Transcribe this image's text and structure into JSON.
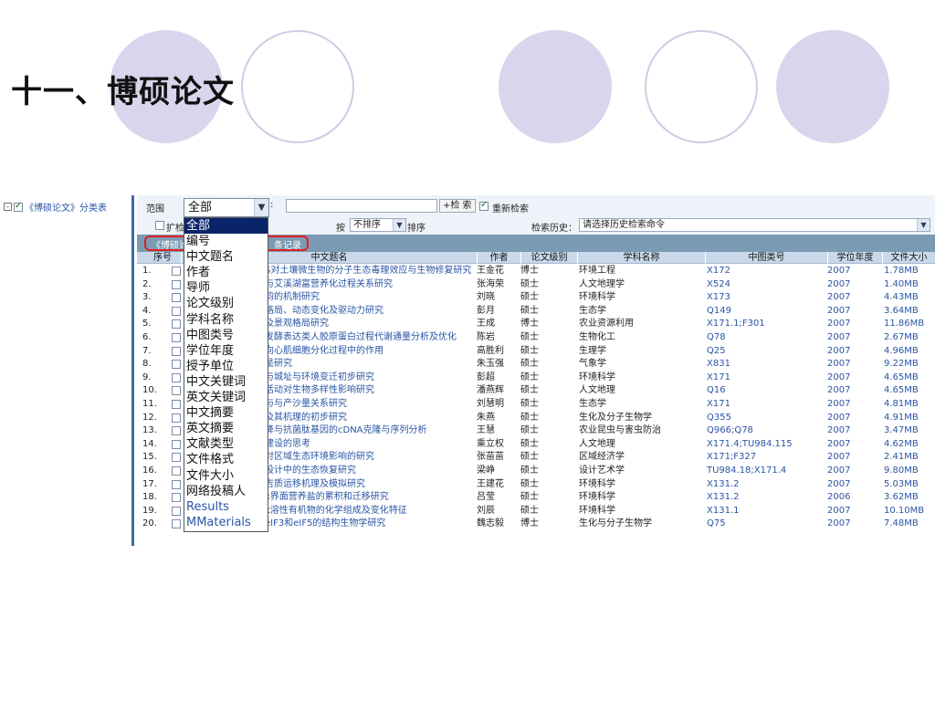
{
  "slide": {
    "title": "十一、博硕论文"
  },
  "tree": {
    "toggle": "-",
    "label": "《博硕论文》分类表"
  },
  "toolbar": {
    "range_label": "范围",
    "colon": ":",
    "search_button": "+检 索",
    "research_label": "重新检索",
    "expand_label": "扩检",
    "sort_prefix": "按",
    "sort_value": "不排序",
    "sort_suffix": "排序",
    "history_label": "检索历史：",
    "history_placeholder": "请选择历史检索命令"
  },
  "banner": {
    "left": "《博硕论",
    "right": "条记录"
  },
  "range_select": {
    "value": "全部",
    "options": [
      "全部",
      "编号",
      "中文题名",
      "作者",
      "导师",
      "论文级别",
      "学科名称",
      "中图类号",
      "学位年度",
      "授予单位",
      "中文关键词",
      "英文关键词",
      "中文摘要",
      "英文摘要",
      "文献类型",
      "文件格式",
      "文件大小",
      "网络投稿人",
      "Results",
      "MMaterials"
    ]
  },
  "table": {
    "headers": [
      "序号",
      "中文题名",
      "作者",
      "论文级别",
      "学科名称",
      "中图类号",
      "学位年度",
      "文件大小"
    ],
    "rows": [
      {
        "no": "1.",
        "title": "S对土壤微生物的分子生态毒理效应与生物修复研究",
        "author": "王金花",
        "level": "博士",
        "subject": "环境工程",
        "class": "X172",
        "year": "2007",
        "size": "1.78MB"
      },
      {
        "no": "2.",
        "title": "与艾溪湖富营养化过程关系研究",
        "author": "张海荣",
        "level": "硕士",
        "subject": "人文地理学",
        "class": "X524",
        "year": "2007",
        "size": "1.40MB"
      },
      {
        "no": "3.",
        "title": "韵的机制研究",
        "author": "刘晓",
        "level": "硕士",
        "subject": "环境科学",
        "class": "X173",
        "year": "2007",
        "size": "4.43MB"
      },
      {
        "no": "4.",
        "title": "格局、动态变化及驱动力研究",
        "author": "彭月",
        "level": "硕士",
        "subject": "生态学",
        "class": "Q149",
        "year": "2007",
        "size": "3.64MB"
      },
      {
        "no": "5.",
        "title": "及景观格局研究",
        "author": "王成",
        "level": "博士",
        "subject": "农业资源利用",
        "class": "X171.1;F301",
        "year": "2007",
        "size": "11.86MB"
      },
      {
        "no": "6.",
        "title": "发酵表达类人胶原蛋白过程代谢通量分析及优化",
        "author": "陈岩",
        "level": "硕士",
        "subject": "生物化工",
        "class": "Q78",
        "year": "2007",
        "size": "2.67MB"
      },
      {
        "no": "7.",
        "title": "向心肌细胞分化过程中的作用",
        "author": "高胜利",
        "level": "硕士",
        "subject": "生理学",
        "class": "Q25",
        "year": "2007",
        "size": "4.96MB"
      },
      {
        "no": "8.",
        "title": "是研究",
        "author": "朱玉强",
        "level": "硕士",
        "subject": "气象学",
        "class": "X831",
        "year": "2007",
        "size": "9.22MB"
      },
      {
        "no": "9.",
        "title": "与城址与环境变迁初步研究",
        "author": "彭超",
        "level": "硕士",
        "subject": "环境科学",
        "class": "X171",
        "year": "2007",
        "size": "4.65MB"
      },
      {
        "no": "10.",
        "title": "活动对生物多样性影响研究",
        "author": "潘燕辉",
        "level": "硕士",
        "subject": "人文地理",
        "class": "Q16",
        "year": "2007",
        "size": "4.65MB"
      },
      {
        "no": "11.",
        "title": "与与产沙量关系研究",
        "author": "刘慧明",
        "level": "硕士",
        "subject": "生态学",
        "class": "X171",
        "year": "2007",
        "size": "4.81MB"
      },
      {
        "no": "12.",
        "title": "及其机理的初步研究",
        "author": "朱燕",
        "level": "硕士",
        "subject": "生化及分子生物学",
        "class": "Q355",
        "year": "2007",
        "size": "4.91MB"
      },
      {
        "no": "13.",
        "title": "降与抗菌肽基因的cDNA克隆与序列分析",
        "author": "王慧",
        "level": "硕士",
        "subject": "农业昆虫与害虫防治",
        "class": "Q966;Q78",
        "year": "2007",
        "size": "3.47MB"
      },
      {
        "no": "14.",
        "title": "建设的思考",
        "author": "乘立权",
        "level": "硕士",
        "subject": "人文地理",
        "class": "X171.4;TU984.115",
        "year": "2007",
        "size": "4.62MB"
      },
      {
        "no": "15.",
        "title": "对区域生态环境影响的研究",
        "author": "张苗苗",
        "level": "硕士",
        "subject": "区域经济学",
        "class": "X171;F327",
        "year": "2007",
        "size": "2.41MB"
      },
      {
        "no": "16.",
        "title": "设计中的生态恢复研究",
        "author": "梁峥",
        "level": "硕士",
        "subject": "设计艺术学",
        "class": "TU984.18;X171.4",
        "year": "2007",
        "size": "9.80MB"
      },
      {
        "no": "17.",
        "title": "吉质运移机理及模拟研究",
        "author": "王建花",
        "level": "硕士",
        "subject": "环境科学",
        "class": "X131.2",
        "year": "2007",
        "size": "5.03MB"
      },
      {
        "no": "18.",
        "title": "k界面营养盐的累积和迁移研究",
        "author": "吕莹",
        "level": "硕士",
        "subject": "环境科学",
        "class": "X131.2",
        "year": "2006",
        "size": "3.62MB"
      },
      {
        "no": "19.",
        "title": "k溶性有机物的化学组成及变化特征",
        "author": "刘辰",
        "level": "硕士",
        "subject": "环境科学",
        "class": "X131.1",
        "year": "2007",
        "size": "10.10MB"
      },
      {
        "no": "20.",
        "title": "eIF3和eIF5的结构生物学研究",
        "author": "魏志毅",
        "level": "博士",
        "subject": "生化与分子生物学",
        "class": "Q75",
        "year": "2007",
        "size": "7.48MB"
      }
    ]
  }
}
